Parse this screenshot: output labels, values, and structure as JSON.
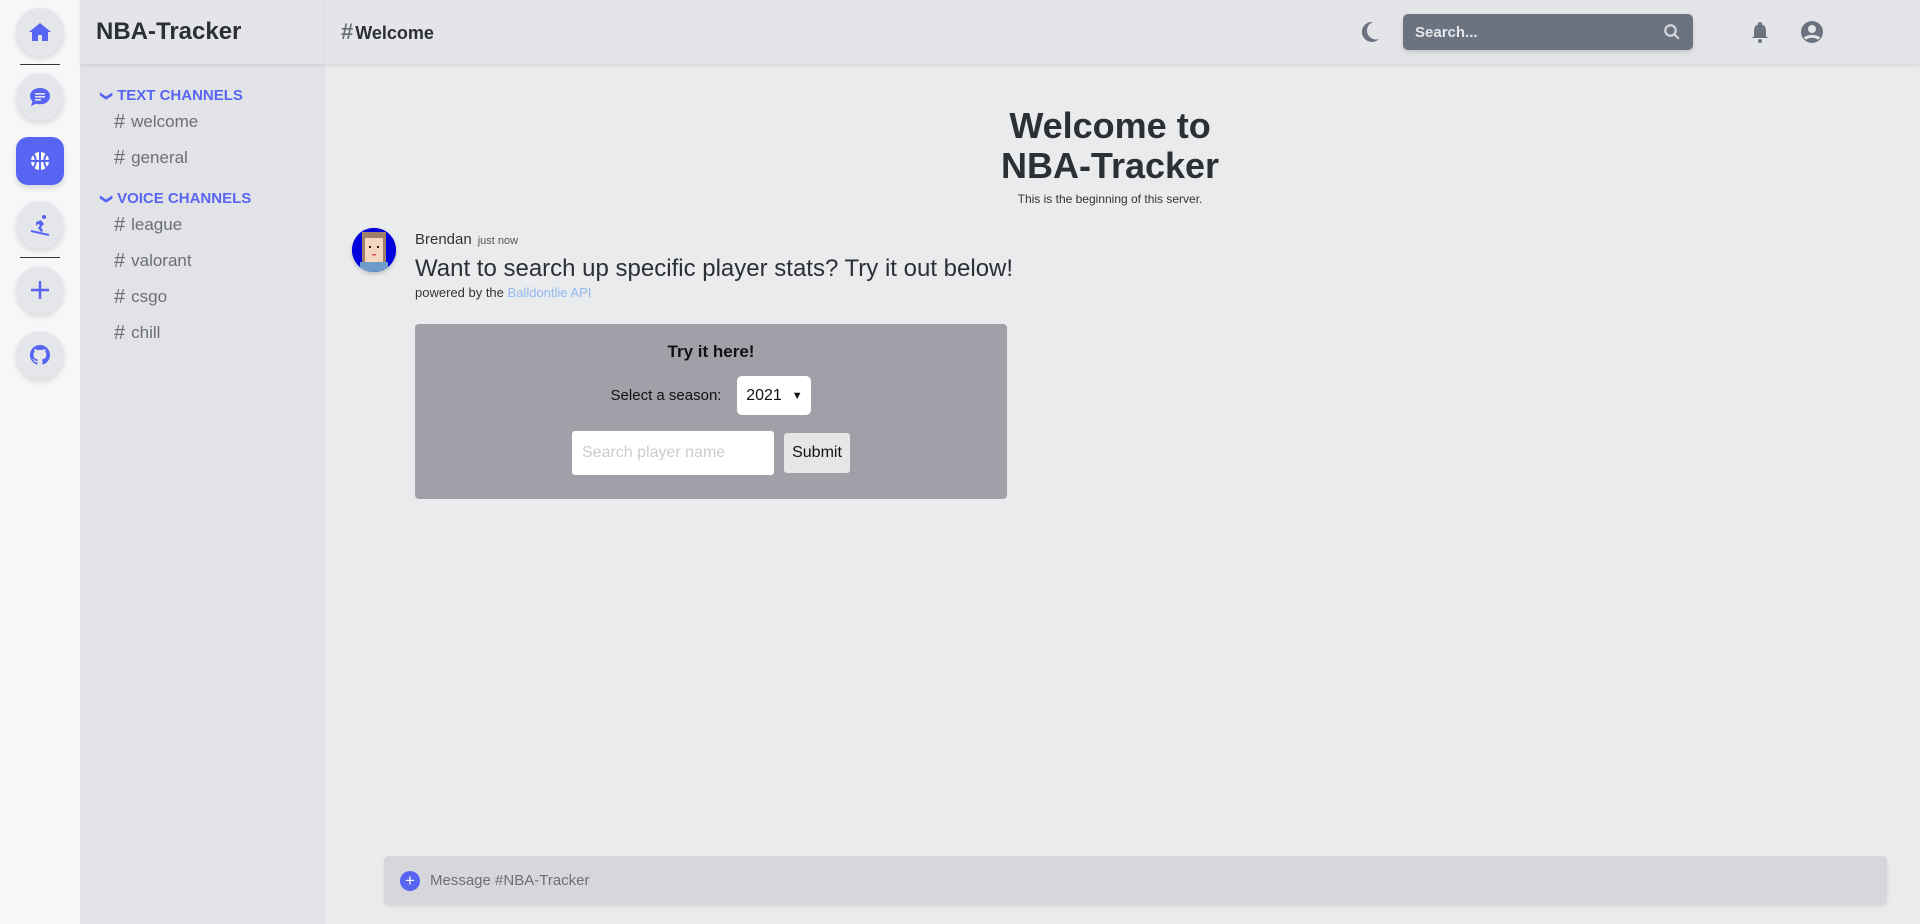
{
  "rail": {
    "items": [
      "home",
      "messages",
      "nba-tracker",
      "snowboard",
      "add-server",
      "github"
    ]
  },
  "sidebar": {
    "server_name": "NBA-Tracker",
    "categories": [
      {
        "label": "TEXT CHANNELS",
        "channels": [
          "welcome",
          "general"
        ]
      },
      {
        "label": "VOICE CHANNELS",
        "channels": [
          "league",
          "valorant",
          "csgo",
          "chill"
        ]
      }
    ],
    "hash": "#"
  },
  "header": {
    "channel": "Welcome",
    "hash": "#",
    "search_placeholder": "Search..."
  },
  "welcome": {
    "line1": "Welcome to",
    "line2": "NBA-Tracker",
    "subtitle": "This is the beginning of this server."
  },
  "message": {
    "author": "Brendan",
    "time": "just now",
    "text": "Want to search up specific player stats? Try it out below!",
    "powered_prefix": "powered by the",
    "powered_link": "Balldontlie API"
  },
  "widget": {
    "title": "Try it here!",
    "season_label": "Select a season:",
    "season_value": "2021",
    "player_placeholder": "Search player name",
    "submit_label": "Submit"
  },
  "composer": {
    "placeholder": "Message #NBA-Tracker"
  },
  "colors": {
    "accent": "#5865f2",
    "widget_bg": "#a1a0a8",
    "search_bg": "#6b7280"
  }
}
